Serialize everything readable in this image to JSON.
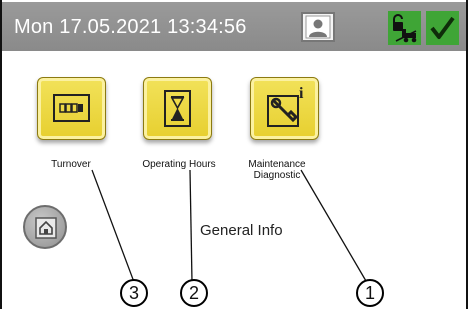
{
  "header": {
    "datetime": "Mon 17.05.2021  13:34:56"
  },
  "tiles": [
    {
      "label": "Turnover",
      "icon": "counter-icon"
    },
    {
      "label": "Operating Hours",
      "icon": "hourglass-icon"
    },
    {
      "label": "Maintenance\nDiagnostic",
      "icon": "wrench-info-icon"
    }
  ],
  "general_info": "General Info",
  "callouts": [
    "3",
    "2",
    "1"
  ],
  "colors": {
    "header": "#8f8f8f",
    "tile": "#ecd73a",
    "green": "#3fa536"
  }
}
